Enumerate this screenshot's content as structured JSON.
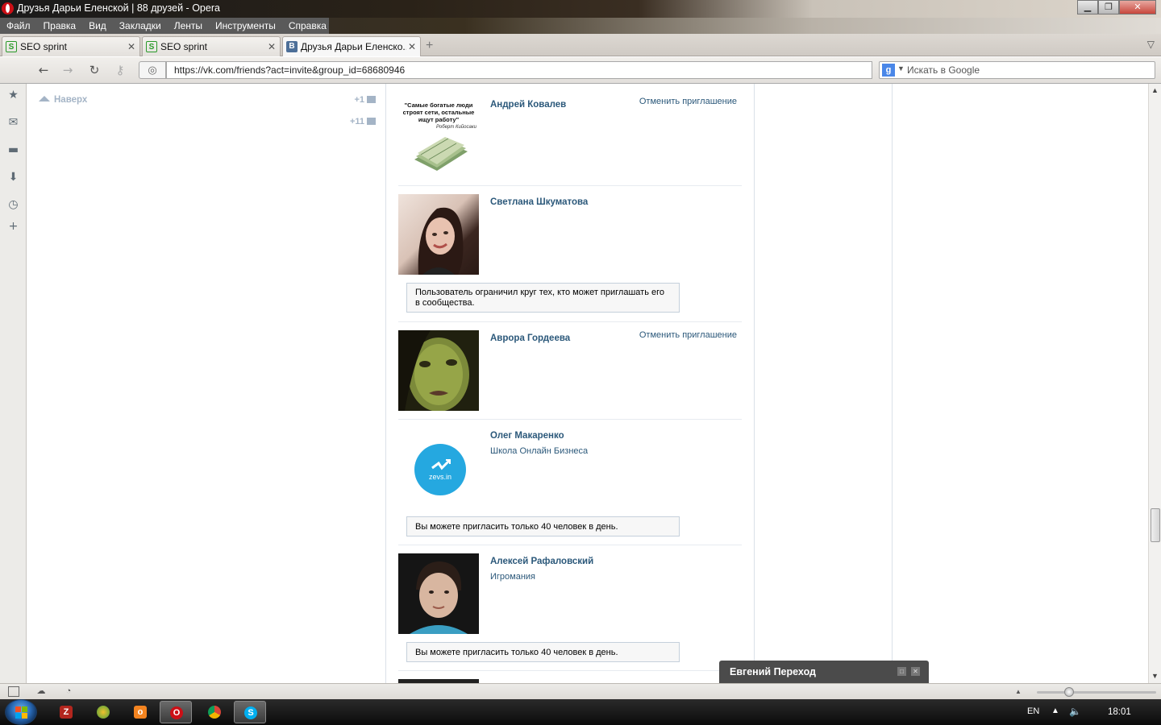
{
  "window": {
    "title": "Друзья Дарьи Еленской | 88 друзей - Opera"
  },
  "menu": [
    "Файл",
    "Правка",
    "Вид",
    "Закладки",
    "Ленты",
    "Инструменты",
    "Справка"
  ],
  "tabs": [
    {
      "label": "SEO sprint"
    },
    {
      "label": "SEO sprint"
    },
    {
      "label": "Друзья Дарьи Еленско..."
    }
  ],
  "address": {
    "url": "https://vk.com/friends?act=invite&group_id=68680946"
  },
  "search": {
    "placeholder": "Искать в Google"
  },
  "left": {
    "up_label": "Наверх",
    "counter_messages": "+1",
    "counter_comments": "+11"
  },
  "friends": [
    {
      "name": "Андрей Ковалев",
      "action": "Отменить приглашение",
      "photo_quote": "\"Самые богатые люди строят сети, остальные ищут работу\"",
      "photo_author": "Роберт Кийосаки"
    },
    {
      "name": "Светлана Шкуматова",
      "note": "Пользователь ограничил круг тех, кто может приглашать его в сообщества."
    },
    {
      "name": "Аврора Гордеева",
      "action": "Отменить приглашение"
    },
    {
      "name": "Олег Макаренко",
      "sub": "Школа Онлайн Бизнеса",
      "note": "Вы можете пригласить только 40 человек в день.",
      "logo_text": "zevs.in"
    },
    {
      "name": "Алексей Рафаловский",
      "sub": "Игромания",
      "note": "Вы можете пригласить только 40 человек в день."
    }
  ],
  "chat": {
    "name": "Евгений Переход"
  },
  "tray": {
    "lang": "EN",
    "time": "18:01"
  },
  "colors": {
    "link": "#2b587a",
    "accent_vk": "#4d6f98",
    "note_border": "#c5d0db"
  }
}
